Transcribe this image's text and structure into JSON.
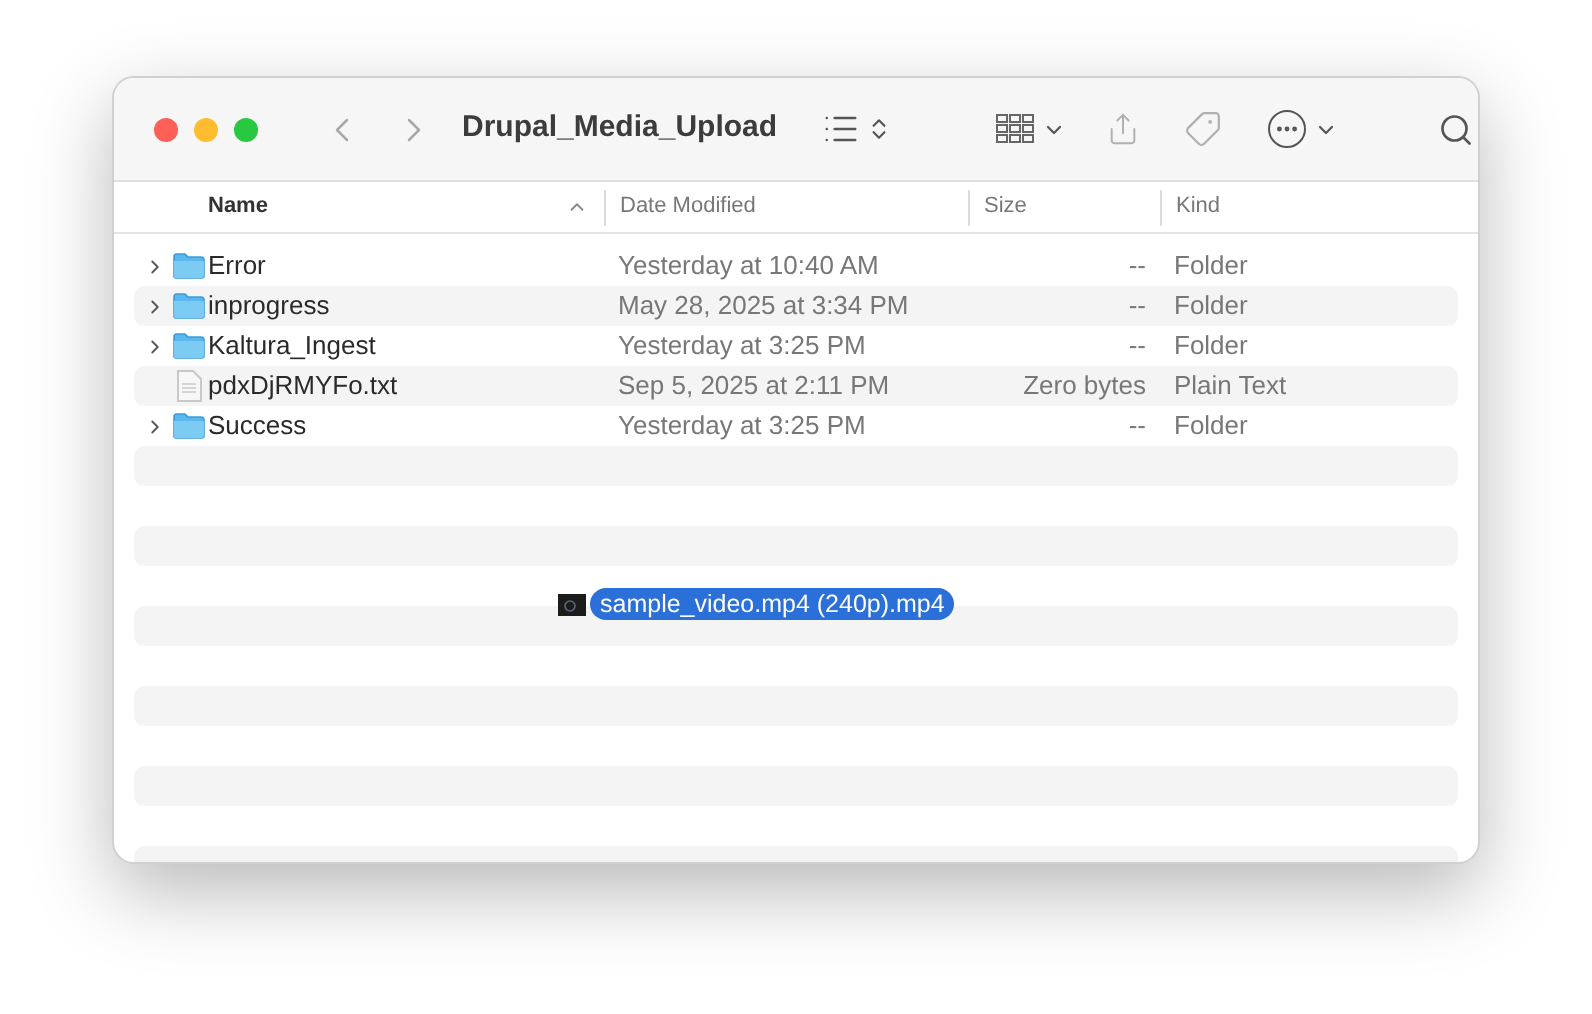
{
  "window": {
    "title": "Drupal_Media_Upload"
  },
  "columns": [
    {
      "label": "Name",
      "sorted": true
    },
    {
      "label": "Date Modified",
      "sorted": false
    },
    {
      "label": "Size",
      "sorted": false
    },
    {
      "label": "Kind",
      "sorted": false
    }
  ],
  "rows": [
    {
      "kind": "folder",
      "name": "Error",
      "date": "Yesterday at 10:40 AM",
      "size": "--",
      "type": "Folder"
    },
    {
      "kind": "folder",
      "name": "inprogress",
      "date": "May 28, 2025 at 3:34 PM",
      "size": "--",
      "type": "Folder"
    },
    {
      "kind": "folder",
      "name": "Kaltura_Ingest",
      "date": "Yesterday at 3:25 PM",
      "size": "--",
      "type": "Folder"
    },
    {
      "kind": "file",
      "name": "pdxDjRMYFo.txt",
      "date": "Sep 5, 2025 at 2:11 PM",
      "size": "Zero bytes",
      "type": "Plain Text"
    },
    {
      "kind": "folder",
      "name": "Success",
      "date": "Yesterday at 3:25 PM",
      "size": "--",
      "type": "Folder"
    }
  ],
  "drag_item": {
    "name": "sample_video.mp4 (240p).mp4"
  }
}
